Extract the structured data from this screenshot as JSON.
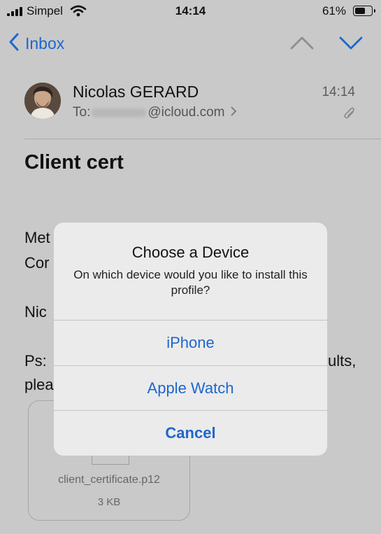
{
  "status_bar": {
    "carrier": "Simpel",
    "time": "14:14",
    "battery": "61%"
  },
  "nav": {
    "back_label": "Inbox"
  },
  "mail": {
    "sender": "Nicolas GERARD",
    "to_prefix": "To:",
    "to_domain": "@icloud.com",
    "time": "14:14",
    "subject": "Client cert",
    "body_fragments": [
      "Met",
      "Cor",
      "Nic",
      "Ps:",
      "ults,",
      "plea"
    ]
  },
  "attachment": {
    "filename": "client_certificate.p12",
    "size": "3 KB"
  },
  "alert": {
    "title": "Choose a Device",
    "message": "On which device would you like to install this profile?",
    "buttons": [
      "iPhone",
      "Apple Watch",
      "Cancel"
    ]
  },
  "colors": {
    "accent": "#1d67cd",
    "dim_background": "#c9c9c9",
    "alert_background": "#ebebeb"
  }
}
